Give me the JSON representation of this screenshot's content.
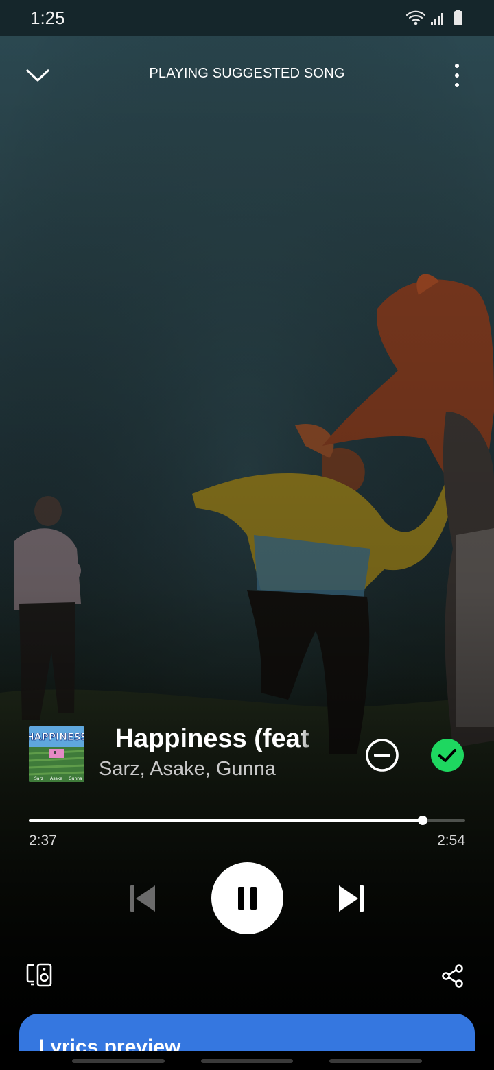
{
  "status_bar": {
    "time": "1:25"
  },
  "header": {
    "title": "PLAYING SUGGESTED SONG"
  },
  "track": {
    "title": "Happiness (feat",
    "artists": "Sarz, Asake, Gunna",
    "album_art_text": "HAPPINESS",
    "album_art_credits": [
      "Sarz",
      "Asake",
      "Gunna"
    ]
  },
  "playback": {
    "elapsed": "2:37",
    "total": "2:54",
    "progress_fraction": 0.902,
    "state": "playing"
  },
  "controls": {
    "previous_enabled": false,
    "liked": true
  },
  "lyrics": {
    "label": "Lyrics preview"
  },
  "colors": {
    "accent_green": "#1ed760",
    "lyrics_card": "#3577e0"
  },
  "icons": {
    "collapse": "chevron-down-icon",
    "more": "more-vertical-icon",
    "hide": "minus-circle-icon",
    "liked": "check-circle-icon",
    "previous": "skip-previous-icon",
    "pause": "pause-icon",
    "next": "skip-next-icon",
    "devices": "connect-devices-icon",
    "share": "share-icon"
  }
}
